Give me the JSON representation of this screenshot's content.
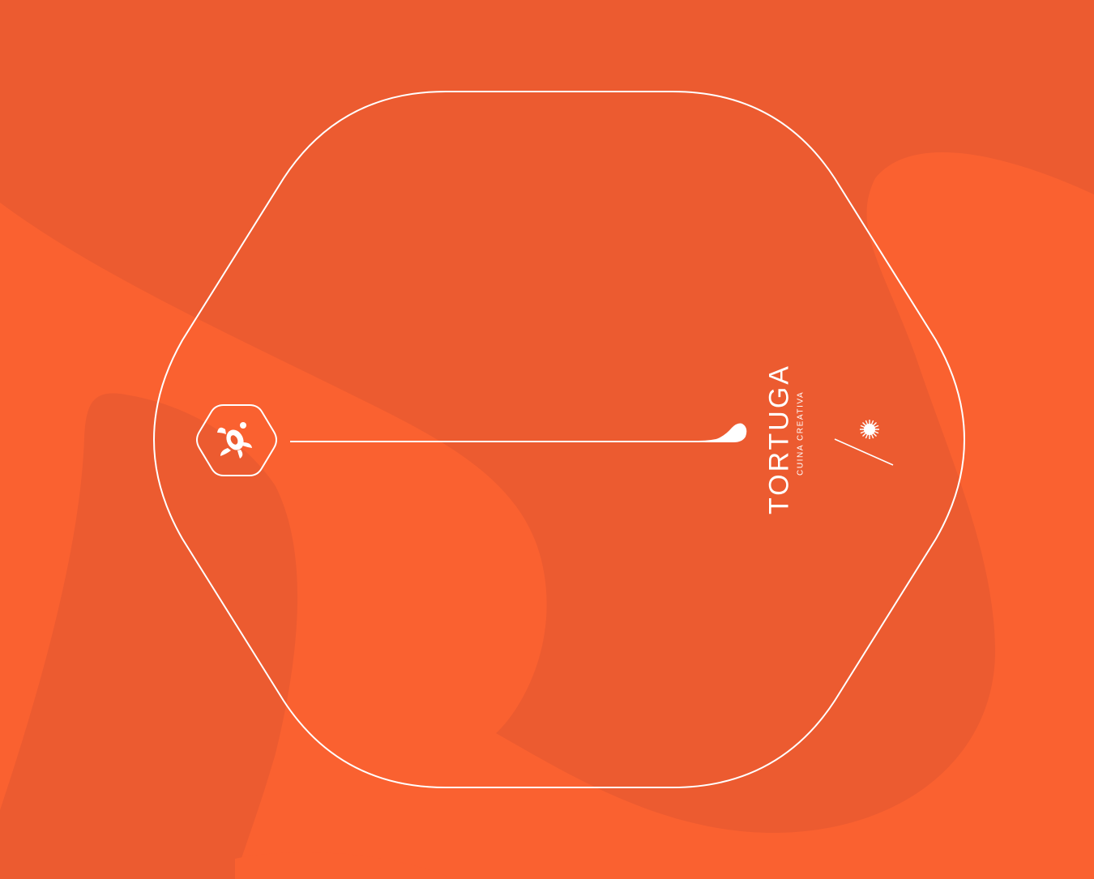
{
  "brand": {
    "name": "TORTUGA",
    "tagline": "CUINA CREATIVA"
  },
  "colors": {
    "background": "#EC5B30",
    "blob": "#FA6130",
    "line": "#FFFFFF"
  },
  "icons": {
    "emblem": "turtle-hexagon-icon",
    "star": "sunburst-star-icon",
    "connector": "droplet-line-icon"
  }
}
